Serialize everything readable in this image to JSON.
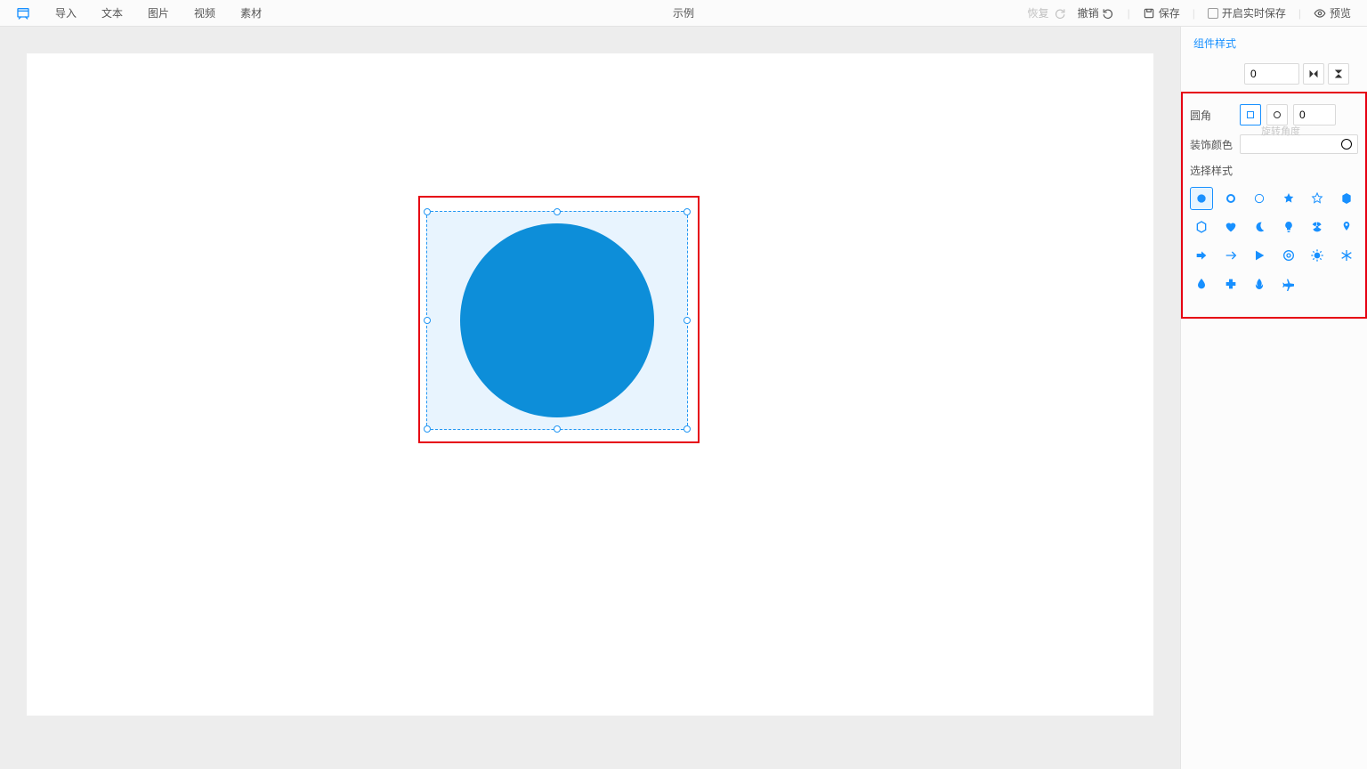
{
  "toolbar": {
    "menu": {
      "import": "导入",
      "text": "文本",
      "image": "图片",
      "video": "视频",
      "material": "素材"
    },
    "center": "示例",
    "right": {
      "redo": "恢复",
      "undo": "撤销",
      "save": "保存",
      "autosave": "开启实时保存",
      "preview": "预览"
    }
  },
  "panel": {
    "title": "组件样式",
    "top_value": "0",
    "rotation_hint": "旋转角度",
    "corner": {
      "label": "圆角",
      "value": "0"
    },
    "decor_color": {
      "label": "装饰颜色"
    },
    "select_style": {
      "label": "选择样式"
    },
    "styles": [
      "circle-filled",
      "circle-bold-outline",
      "circle-outline",
      "star-filled",
      "star-outline",
      "hexagon-filled",
      "hexagon-outline",
      "heart-filled",
      "moon",
      "lightbulb",
      "radiation",
      "pin",
      "arrow-right-filled",
      "arrow-right",
      "caret-right",
      "target",
      "sun-gear",
      "snowflake",
      "drop",
      "plus",
      "fire",
      "plane"
    ]
  },
  "canvas": {
    "selected_shape": "circle",
    "shape_color": "#0d8ed9"
  }
}
